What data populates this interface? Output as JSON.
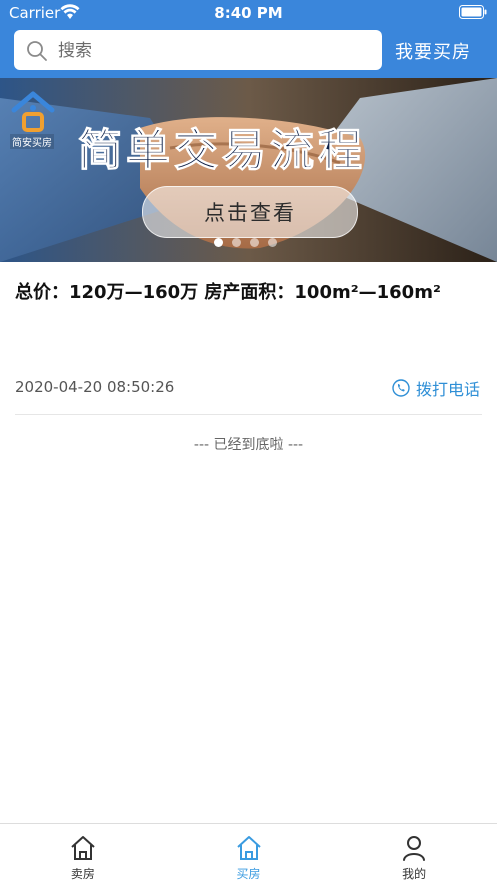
{
  "status_bar": {
    "carrier": "Carrier",
    "time": "8:40 PM"
  },
  "search": {
    "placeholder": "搜索",
    "buy_link": "我要买房"
  },
  "banner": {
    "brand_name": "简安买房",
    "title": "简单交易流程",
    "button_label": "点击查看",
    "pages": 4,
    "active_page": 1
  },
  "listing": {
    "title": "总价：120万—160万 房产面积：100m²—160m²",
    "timestamp": "2020-04-20 08:50:26",
    "call_label": "拨打电话"
  },
  "end_note": "--- 已经到底啦 ---",
  "tabbar": {
    "tabs": [
      {
        "label": "卖房",
        "icon": "house-icon",
        "active": false
      },
      {
        "label": "买房",
        "icon": "house-icon",
        "active": true
      },
      {
        "label": "我的",
        "icon": "user-icon",
        "active": false
      }
    ]
  },
  "colors": {
    "header_blue": "#3a86db",
    "accent_blue": "#3a9be0",
    "call_blue": "#2f8fd6"
  }
}
